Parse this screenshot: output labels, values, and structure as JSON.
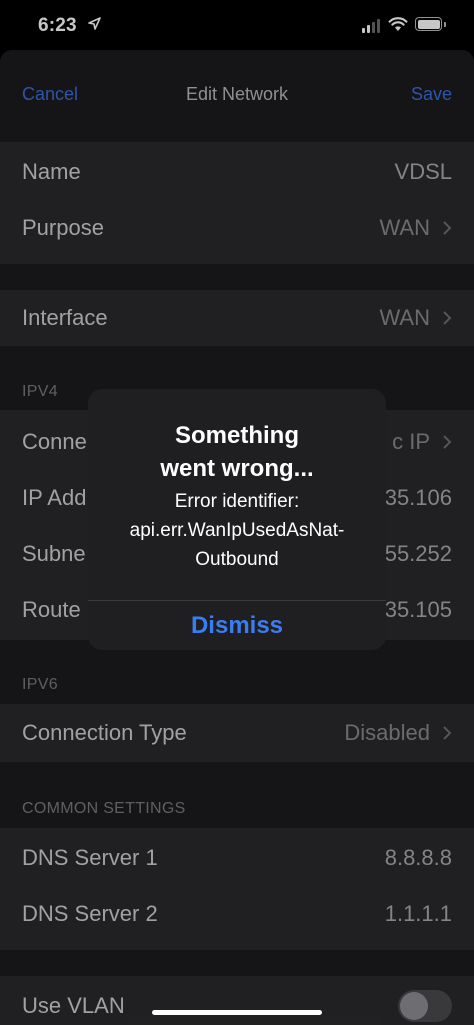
{
  "status_bar": {
    "time": "6:23"
  },
  "nav": {
    "cancel": "Cancel",
    "title": "Edit Network",
    "save": "Save"
  },
  "general": {
    "name_label": "Name",
    "name_value": "VDSL",
    "purpose_label": "Purpose",
    "purpose_value": "WAN"
  },
  "interface": {
    "label": "Interface",
    "value": "WAN"
  },
  "ipv4": {
    "header": "IPV4",
    "rows": [
      {
        "label": "Conne",
        "value": "c IP"
      },
      {
        "label": "IP Add",
        "value": "35.106"
      },
      {
        "label": "Subne",
        "value": "55.252"
      },
      {
        "label": "Route",
        "value": "35.105"
      }
    ]
  },
  "ipv6": {
    "header": "IPV6",
    "connection_type_label": "Connection Type",
    "connection_type_value": "Disabled"
  },
  "common": {
    "header": "COMMON SETTINGS",
    "dns1_label": "DNS Server 1",
    "dns1_value": "8.8.8.8",
    "dns2_label": "DNS Server 2",
    "dns2_value": "1.1.1.1"
  },
  "vlan": {
    "label": "Use VLAN",
    "enabled": false
  },
  "alert": {
    "title": "Something went wrong...",
    "message_line1": "Error identifier:",
    "message_line2": "api.err.WanIpUsedAsNat-",
    "message_line3": "Outbound",
    "dismiss": "Dismiss"
  },
  "colors": {
    "accent": "#3a6ed9",
    "alert_button": "#3b7df0"
  },
  "icons": [
    "location-arrow-icon",
    "cellular-signal-icon",
    "wifi-icon",
    "battery-icon",
    "chevron-right-icon"
  ]
}
